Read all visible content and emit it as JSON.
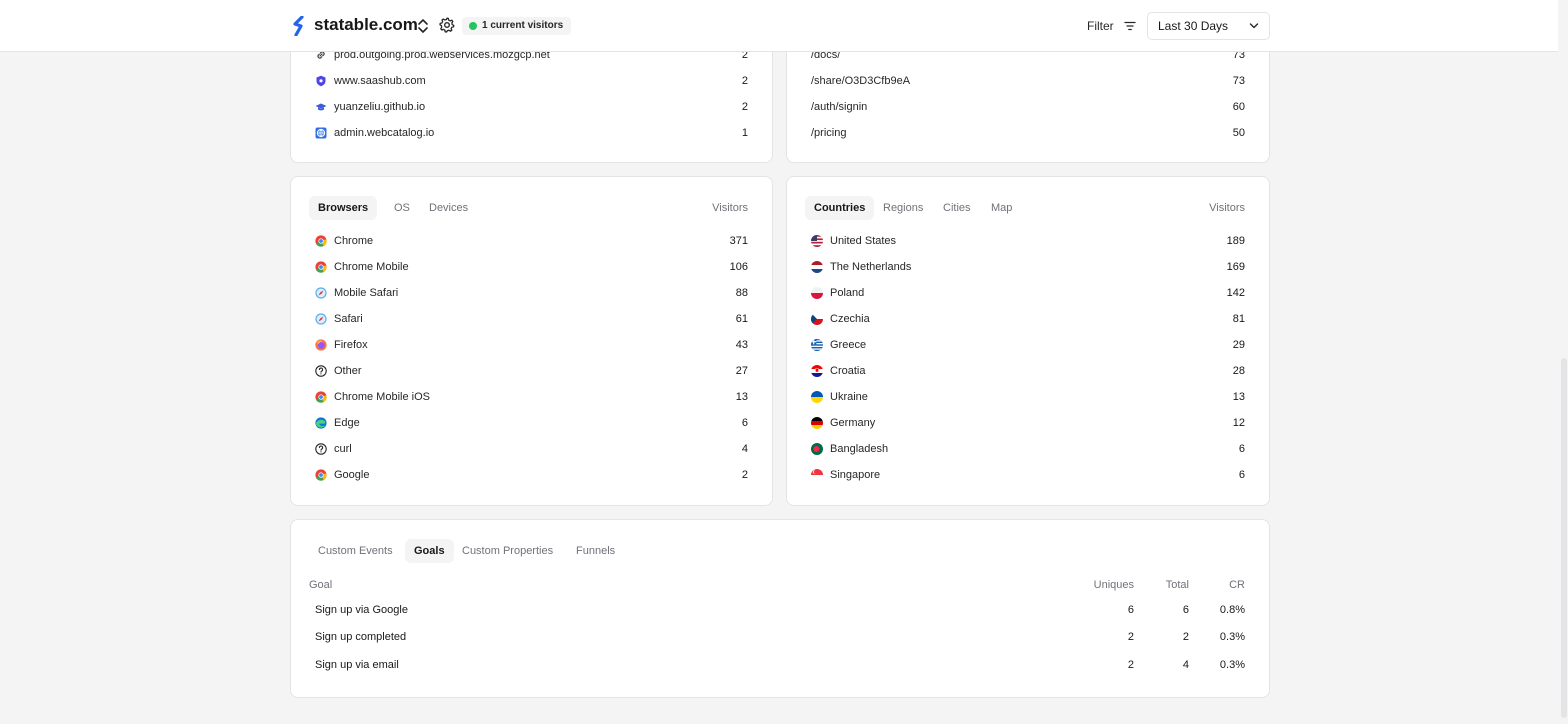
{
  "header": {
    "site_name": "statable.com",
    "visitors_pill": "1 current visitors",
    "filter_label": "Filter",
    "date_range": "Last 30 Days",
    "brand_color": "#2563eb",
    "live_color": "#22c55e"
  },
  "referrers": [
    {
      "label": "prod.outgoing.prod.webservices.mozgcp.net",
      "value": "2",
      "icon": "link-icon"
    },
    {
      "label": "www.saashub.com",
      "value": "2",
      "icon": "shield-icon"
    },
    {
      "label": "yuanzeliu.github.io",
      "value": "2",
      "icon": "graduation-cap-icon"
    },
    {
      "label": "admin.webcatalog.io",
      "value": "1",
      "icon": "webcatalog-icon"
    }
  ],
  "pages": [
    {
      "label": "/docs/",
      "value": "73"
    },
    {
      "label": "/share/O3D3Cfb9eA",
      "value": "73"
    },
    {
      "label": "/auth/signin",
      "value": "60"
    },
    {
      "label": "/pricing",
      "value": "50"
    }
  ],
  "tech": {
    "tabs": [
      "Browsers",
      "OS",
      "Devices"
    ],
    "column": "Visitors",
    "rows": [
      {
        "label": "Chrome",
        "value": "371",
        "icon": "chrome-icon"
      },
      {
        "label": "Chrome Mobile",
        "value": "106",
        "icon": "chrome-icon"
      },
      {
        "label": "Mobile Safari",
        "value": "88",
        "icon": "safari-icon"
      },
      {
        "label": "Safari",
        "value": "61",
        "icon": "safari-icon"
      },
      {
        "label": "Firefox",
        "value": "43",
        "icon": "firefox-icon"
      },
      {
        "label": "Other",
        "value": "27",
        "icon": "question-icon"
      },
      {
        "label": "Chrome Mobile iOS",
        "value": "13",
        "icon": "chrome-icon"
      },
      {
        "label": "Edge",
        "value": "6",
        "icon": "edge-icon"
      },
      {
        "label": "curl",
        "value": "4",
        "icon": "question-icon"
      },
      {
        "label": "Google",
        "value": "2",
        "icon": "chrome-icon"
      }
    ]
  },
  "geo": {
    "tabs": [
      "Countries",
      "Regions",
      "Cities",
      "Map"
    ],
    "column": "Visitors",
    "rows": [
      {
        "label": "United States",
        "value": "189",
        "icon": "flag-us-icon"
      },
      {
        "label": "The Netherlands",
        "value": "169",
        "icon": "flag-nl-icon"
      },
      {
        "label": "Poland",
        "value": "142",
        "icon": "flag-pl-icon"
      },
      {
        "label": "Czechia",
        "value": "81",
        "icon": "flag-cz-icon"
      },
      {
        "label": "Greece",
        "value": "29",
        "icon": "flag-gr-icon"
      },
      {
        "label": "Croatia",
        "value": "28",
        "icon": "flag-hr-icon"
      },
      {
        "label": "Ukraine",
        "value": "13",
        "icon": "flag-ua-icon"
      },
      {
        "label": "Germany",
        "value": "12",
        "icon": "flag-de-icon"
      },
      {
        "label": "Bangladesh",
        "value": "6",
        "icon": "flag-bd-icon"
      },
      {
        "label": "Singapore",
        "value": "6",
        "icon": "flag-sg-icon"
      }
    ]
  },
  "events": {
    "tabs": [
      "Custom Events",
      "Goals",
      "Custom Properties",
      "Funnels"
    ],
    "columns": {
      "goal": "Goal",
      "uniques": "Uniques",
      "total": "Total",
      "cr": "CR"
    },
    "rows": [
      {
        "goal": "Sign up via Google",
        "uniques": "6",
        "total": "6",
        "cr": "0.8%"
      },
      {
        "goal": "Sign up completed",
        "uniques": "2",
        "total": "2",
        "cr": "0.3%"
      },
      {
        "goal": "Sign up via email",
        "uniques": "2",
        "total": "4",
        "cr": "0.3%"
      }
    ]
  }
}
